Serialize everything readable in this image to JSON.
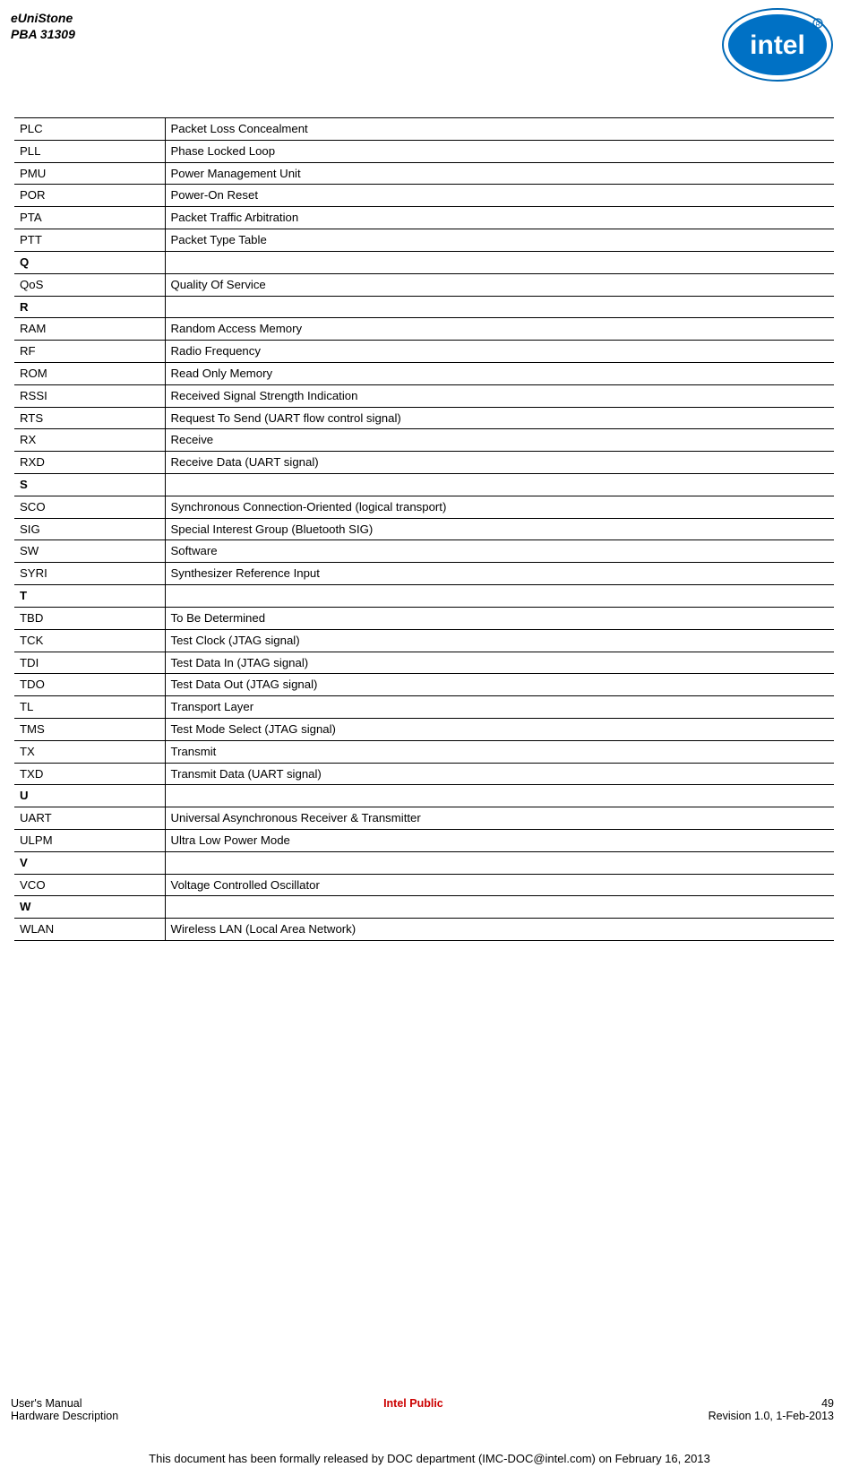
{
  "header": {
    "line1": "eUniStone",
    "line2": "PBA 31309"
  },
  "rows": [
    {
      "term": "PLC",
      "def": "Packet Loss Concealment"
    },
    {
      "term": "PLL",
      "def": "Phase Locked Loop"
    },
    {
      "term": "PMU",
      "def": "Power Management Unit"
    },
    {
      "term": "POR",
      "def": "Power-On Reset"
    },
    {
      "term": "PTA",
      "def": "Packet Traffic Arbitration"
    },
    {
      "term": "PTT",
      "def": "Packet Type Table"
    },
    {
      "term": "Q",
      "def": "",
      "section": true
    },
    {
      "term": "QoS",
      "def": "Quality Of Service"
    },
    {
      "term": "R",
      "def": "",
      "section": true
    },
    {
      "term": "RAM",
      "def": "Random Access Memory"
    },
    {
      "term": "RF",
      "def": "Radio Frequency"
    },
    {
      "term": "ROM",
      "def": "Read Only Memory"
    },
    {
      "term": "RSSI",
      "def": "Received Signal Strength Indication"
    },
    {
      "term": "RTS",
      "def": "Request To Send (UART flow control signal)"
    },
    {
      "term": "RX",
      "def": "Receive"
    },
    {
      "term": "RXD",
      "def": "Receive Data (UART signal)"
    },
    {
      "term": "S",
      "def": "",
      "section": true
    },
    {
      "term": "SCO",
      "def": "Synchronous Connection-Oriented (logical transport)"
    },
    {
      "term": "SIG",
      "def": "Special Interest Group (Bluetooth SIG)"
    },
    {
      "term": "SW",
      "def": "Software"
    },
    {
      "term": "SYRI",
      "def": "Synthesizer Reference Input"
    },
    {
      "term": "T",
      "def": "",
      "section": true
    },
    {
      "term": "TBD",
      "def": "To Be Determined"
    },
    {
      "term": "TCK",
      "def": "Test Clock (JTAG signal)"
    },
    {
      "term": "TDI",
      "def": "Test Data In (JTAG signal)"
    },
    {
      "term": "TDO",
      "def": "Test Data Out (JTAG signal)"
    },
    {
      "term": "TL",
      "def": "Transport Layer"
    },
    {
      "term": "TMS",
      "def": "Test Mode Select (JTAG signal)"
    },
    {
      "term": "TX",
      "def": "Transmit"
    },
    {
      "term": "TXD",
      "def": "Transmit Data (UART signal)"
    },
    {
      "term": "U",
      "def": "",
      "section": true
    },
    {
      "term": "UART",
      "def": "Universal Asynchronous Receiver & Transmitter"
    },
    {
      "term": "ULPM",
      "def": "Ultra Low Power Mode"
    },
    {
      "term": "V",
      "def": "",
      "section": true
    },
    {
      "term": "VCO",
      "def": "Voltage Controlled Oscillator"
    },
    {
      "term": "W",
      "def": "",
      "section": true
    },
    {
      "term": "WLAN",
      "def": "Wireless LAN (Local Area Network)"
    }
  ],
  "footer": {
    "left1": "User's Manual",
    "left2": "Hardware Description",
    "center": "Intel Public",
    "right1": "49",
    "right2": "Revision 1.0, 1-Feb-2013",
    "release": "This document has been formally released by DOC department (IMC-DOC@intel.com) on February 16, 2013"
  }
}
